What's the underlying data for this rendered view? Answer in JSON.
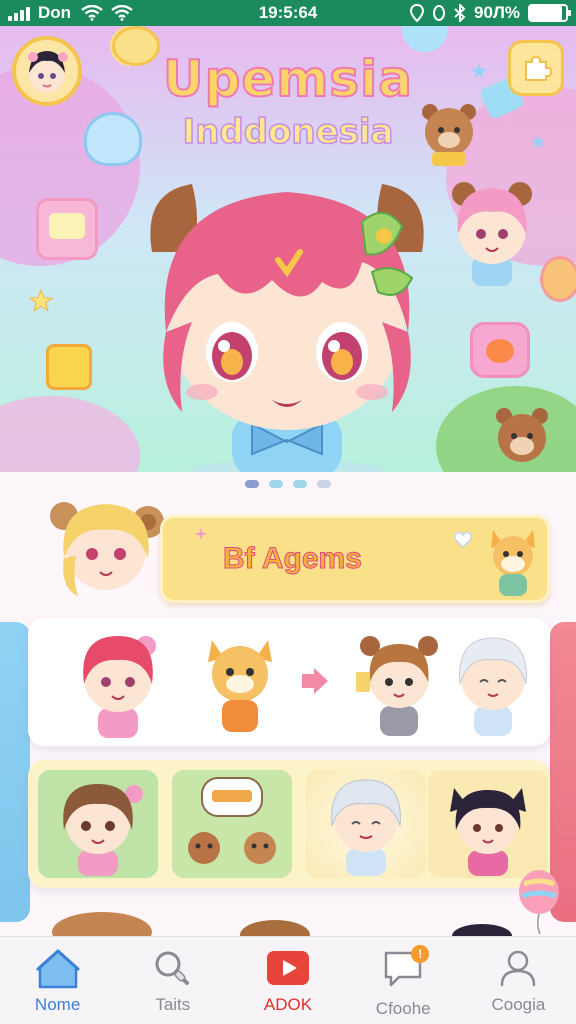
{
  "status_bar": {
    "carrier": "Don",
    "time": "19:5:64",
    "battery_text": "90Л%",
    "battery_level": 0.9,
    "icons": [
      "signal-icon",
      "wifi-icon",
      "wifi-icon",
      "location-icon",
      "alarm-icon",
      "bluetooth-icon",
      "battery-icon"
    ]
  },
  "hero": {
    "title": "Upemsia",
    "subtitle": "Inddonesia",
    "carousel_page_count": 4,
    "carousel_active_index": 0
  },
  "banner": {
    "label": "Bf Agems"
  },
  "bottom_nav": {
    "items": [
      {
        "label": "Nome",
        "icon": "home-icon",
        "active": true
      },
      {
        "label": "Taits",
        "icon": "search-icon",
        "active": false
      },
      {
        "label": "ADOK",
        "icon": "play-icon",
        "active": false
      },
      {
        "label": "Cfoohe",
        "icon": "chat-icon",
        "active": false,
        "badge": "!"
      },
      {
        "label": "Coogia",
        "icon": "profile-icon",
        "active": false
      }
    ]
  },
  "colors": {
    "status_bar": "#1b8a5c",
    "nav_active": "#3b7fd6",
    "nav_play": "#e0302e",
    "banner": "#fbe08a"
  }
}
